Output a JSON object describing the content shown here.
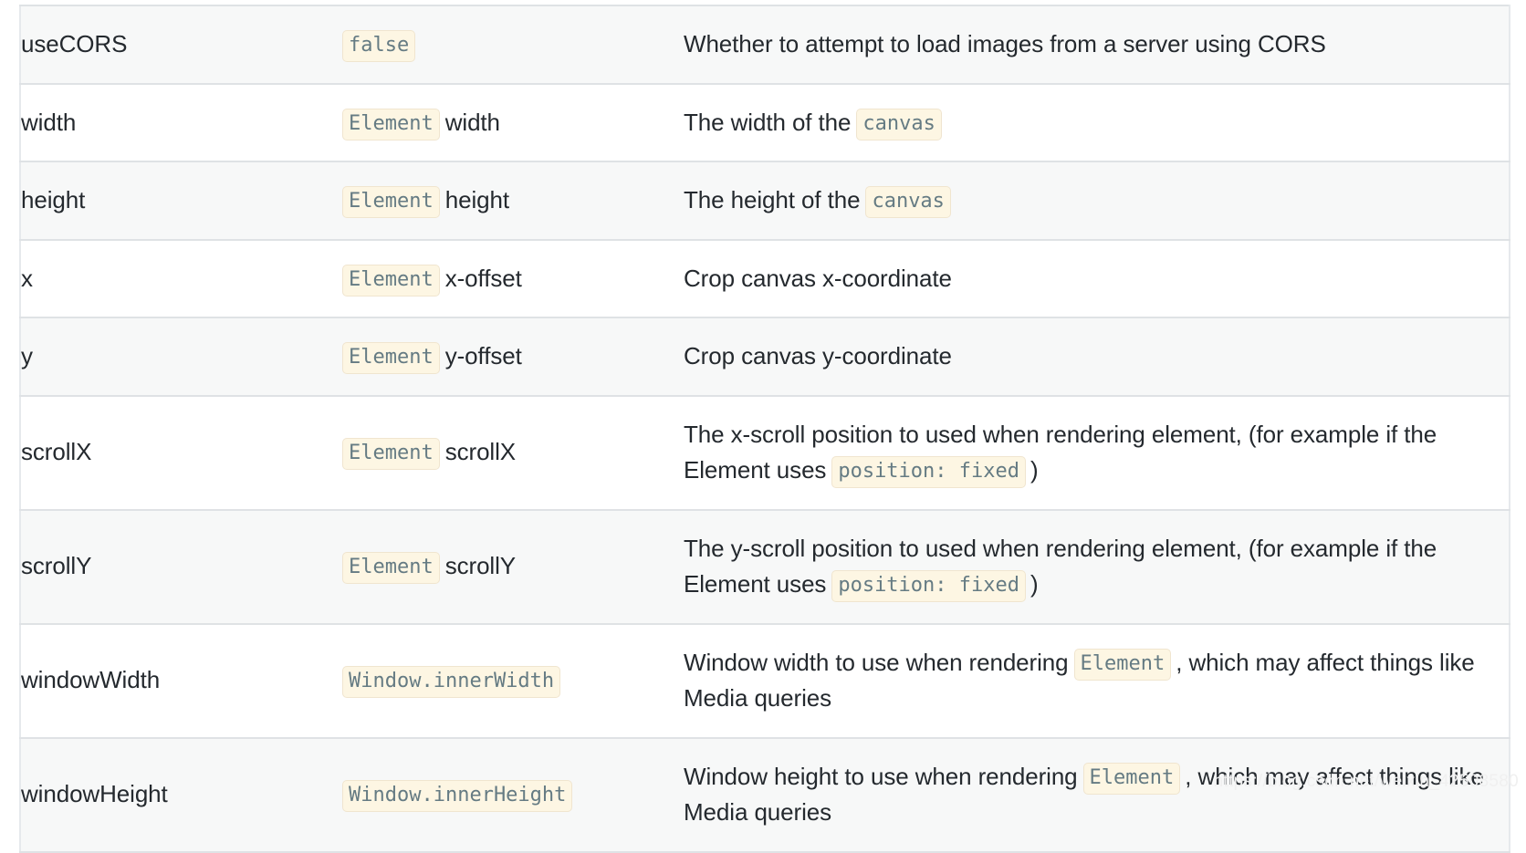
{
  "theme": {
    "page_background": "#ffffff",
    "row_background_odd": "#f7f8f8",
    "row_background_even": "#ffffff",
    "border_color": "#dfe2e5",
    "text_color": "#24292e",
    "code_background": "#fdf6e3",
    "code_border": "#f0e5cf",
    "code_text": "#657b83",
    "watermark_color": "#f0f0f0"
  },
  "watermark": {
    "text": "https://blog.csdn.net/weixin_42508580"
  },
  "table": {
    "rows": [
      {
        "name": "useCORS",
        "default": [
          {
            "type": "code",
            "text": "false"
          }
        ],
        "description": [
          {
            "type": "text",
            "text": "Whether to attempt to load images from a server using CORS"
          }
        ]
      },
      {
        "name": "width",
        "default": [
          {
            "type": "code",
            "text": "Element"
          },
          {
            "type": "text",
            "text": "width"
          }
        ],
        "description": [
          {
            "type": "text",
            "text": "The width of the"
          },
          {
            "type": "code",
            "text": "canvas"
          }
        ]
      },
      {
        "name": "height",
        "default": [
          {
            "type": "code",
            "text": "Element"
          },
          {
            "type": "text",
            "text": "height"
          }
        ],
        "description": [
          {
            "type": "text",
            "text": "The height of the"
          },
          {
            "type": "code",
            "text": "canvas"
          }
        ]
      },
      {
        "name": "x",
        "default": [
          {
            "type": "code",
            "text": "Element"
          },
          {
            "type": "text",
            "text": "x-offset"
          }
        ],
        "description": [
          {
            "type": "text",
            "text": "Crop canvas x-coordinate"
          }
        ]
      },
      {
        "name": "y",
        "default": [
          {
            "type": "code",
            "text": "Element"
          },
          {
            "type": "text",
            "text": "y-offset"
          }
        ],
        "description": [
          {
            "type": "text",
            "text": "Crop canvas y-coordinate"
          }
        ]
      },
      {
        "name": "scrollX",
        "default": [
          {
            "type": "code",
            "text": "Element"
          },
          {
            "type": "text",
            "text": "scrollX"
          }
        ],
        "description": [
          {
            "type": "text",
            "text": "The x-scroll position to used when rendering element, (for example if the Element uses"
          },
          {
            "type": "code",
            "text": "position: fixed"
          },
          {
            "type": "text",
            "text": ")"
          }
        ]
      },
      {
        "name": "scrollY",
        "default": [
          {
            "type": "code",
            "text": "Element"
          },
          {
            "type": "text",
            "text": "scrollY"
          }
        ],
        "description": [
          {
            "type": "text",
            "text": "The y-scroll position to used when rendering element, (for example if the Element uses"
          },
          {
            "type": "code",
            "text": "position: fixed"
          },
          {
            "type": "text",
            "text": ")"
          }
        ]
      },
      {
        "name": "windowWidth",
        "default": [
          {
            "type": "code",
            "text": "Window.innerWidth"
          }
        ],
        "description": [
          {
            "type": "text",
            "text": "Window width to use when rendering"
          },
          {
            "type": "code",
            "text": "Element"
          },
          {
            "type": "text",
            "text": ", which may affect things like Media queries"
          }
        ]
      },
      {
        "name": "windowHeight",
        "default": [
          {
            "type": "code",
            "text": "Window.innerHeight"
          }
        ],
        "description": [
          {
            "type": "text",
            "text": "Window height to use when rendering"
          },
          {
            "type": "code",
            "text": "Element"
          },
          {
            "type": "text",
            "text": ", which may affect things like Media queries"
          }
        ]
      }
    ]
  }
}
